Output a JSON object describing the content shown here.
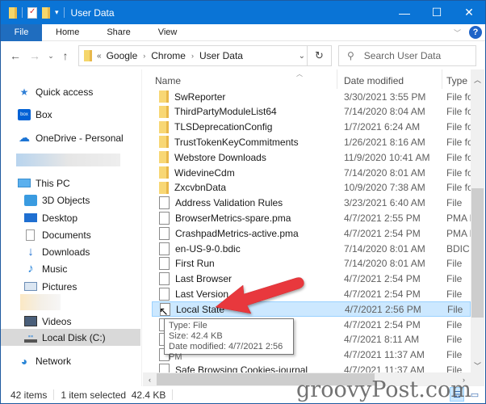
{
  "window": {
    "title": "User Data",
    "controls": {
      "minimize": "—",
      "maximize": "☐",
      "close": "✕"
    }
  },
  "ribbon": {
    "tabs": [
      "File",
      "Home",
      "Share",
      "View"
    ],
    "expand_icon": "chevron-down-icon",
    "help": "?"
  },
  "nav": {
    "back": "←",
    "forward": "→",
    "recent": "⌄",
    "up": "↑",
    "breadcrumb_overflow": "«",
    "breadcrumb": [
      "Google",
      "Chrome",
      "User Data"
    ],
    "refresh": "↻",
    "search_placeholder": "Search User Data"
  },
  "sidebar": {
    "items": [
      {
        "label": "Quick access",
        "icon": "star-icon",
        "color": "#2f7fd6"
      },
      {
        "label": "Box",
        "icon": "box-icon",
        "color": "#0061d5"
      },
      {
        "label": "OneDrive - Personal",
        "icon": "cloud-icon",
        "color": "#1c74d4"
      },
      {
        "label": "This PC",
        "icon": "computer-icon",
        "color": "#4aa0e6"
      },
      {
        "label": "3D Objects",
        "icon": "cube-icon",
        "color": "#3a9be0"
      },
      {
        "label": "Desktop",
        "icon": "desktop-icon",
        "color": "#1f6fd1"
      },
      {
        "label": "Documents",
        "icon": "document-icon",
        "color": "#9a9a9a"
      },
      {
        "label": "Downloads",
        "icon": "download-icon",
        "color": "#1f6fd1"
      },
      {
        "label": "Music",
        "icon": "music-icon",
        "color": "#1f7fd9"
      },
      {
        "label": "Pictures",
        "icon": "pictures-icon",
        "color": "#6b8db5"
      },
      {
        "label": "Videos",
        "icon": "videos-icon",
        "color": "#4a5f7a"
      },
      {
        "label": "Local Disk (C:)",
        "icon": "drive-icon",
        "color": "#6aa1d8",
        "selected": true
      },
      {
        "label": "Network",
        "icon": "network-icon",
        "color": "#2b86d6"
      }
    ]
  },
  "list": {
    "columns": {
      "name": "Name",
      "date": "Date modified",
      "type": "Type"
    },
    "rows": [
      {
        "name": "SwReporter",
        "date": "3/30/2021 3:55 PM",
        "type": "File folder",
        "kind": "folder"
      },
      {
        "name": "ThirdPartyModuleList64",
        "date": "7/14/2020 8:04 AM",
        "type": "File folder",
        "kind": "folder"
      },
      {
        "name": "TLSDeprecationConfig",
        "date": "1/7/2021 6:24 AM",
        "type": "File folder",
        "kind": "folder"
      },
      {
        "name": "TrustTokenKeyCommitments",
        "date": "1/26/2021 8:16 AM",
        "type": "File folder",
        "kind": "folder"
      },
      {
        "name": "Webstore Downloads",
        "date": "11/9/2020 10:41 AM",
        "type": "File folder",
        "kind": "folder"
      },
      {
        "name": "WidevineCdm",
        "date": "7/14/2020 8:01 AM",
        "type": "File folder",
        "kind": "folder"
      },
      {
        "name": "ZxcvbnData",
        "date": "10/9/2020 7:38 AM",
        "type": "File folder",
        "kind": "folder"
      },
      {
        "name": "Address Validation Rules",
        "date": "3/23/2021 6:40 AM",
        "type": "File",
        "kind": "file"
      },
      {
        "name": "BrowserMetrics-spare.pma",
        "date": "4/7/2021 2:55 PM",
        "type": "PMA File",
        "kind": "file"
      },
      {
        "name": "CrashpadMetrics-active.pma",
        "date": "4/7/2021 2:54 PM",
        "type": "PMA File",
        "kind": "file"
      },
      {
        "name": "en-US-9-0.bdic",
        "date": "7/14/2020 8:01 AM",
        "type": "BDIC File",
        "kind": "file"
      },
      {
        "name": "First Run",
        "date": "7/14/2020 8:01 AM",
        "type": "File",
        "kind": "file"
      },
      {
        "name": "Last Browser",
        "date": "4/7/2021 2:54 PM",
        "type": "File",
        "kind": "file"
      },
      {
        "name": "Last Version",
        "date": "4/7/2021 2:54 PM",
        "type": "File",
        "kind": "file"
      },
      {
        "name": "Local State",
        "date": "4/7/2021 2:56 PM",
        "type": "File",
        "kind": "file",
        "selected": true
      },
      {
        "name": "",
        "date": "4/7/2021 2:54 PM",
        "type": "File",
        "kind": "file"
      },
      {
        "name": "",
        "date": "4/7/2021 8:11 AM",
        "type": "File",
        "kind": "file"
      },
      {
        "name": "",
        "date": "4/7/2021 11:37 AM",
        "type": "File",
        "kind": "file"
      },
      {
        "name": "Safe Browsing Cookies-journal",
        "date": "4/7/2021 11:37 AM",
        "type": "File",
        "kind": "file"
      }
    ]
  },
  "tooltip": {
    "lines": [
      "Type: File",
      "Size: 42.4 KB",
      "Date modified: 4/7/2021 2:56 PM"
    ]
  },
  "status": {
    "items_count": "42 items",
    "selection": "1 item selected  42.4 KB"
  },
  "scrollbar": {
    "vertical_position_fraction": 0.72,
    "horizontal_position_fraction": 0.0
  },
  "annotation": {
    "arrow_color": "#e8383d",
    "target": "Local State"
  },
  "watermark": "groovyPost.com"
}
